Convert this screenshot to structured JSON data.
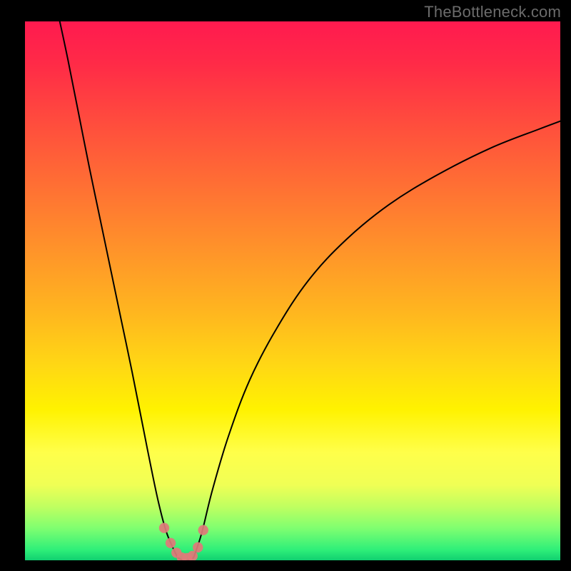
{
  "watermark": "TheBottleneck.com",
  "colors": {
    "background": "#000000",
    "watermark": "#6b6b6b",
    "curve_stroke": "#000000",
    "marker": "#e07a7a",
    "gradient_top": "#ff1a4f",
    "gradient_bottom": "#10d070"
  },
  "chart_data": {
    "type": "line",
    "title": "",
    "xlabel": "",
    "ylabel": "",
    "xlim": [
      0,
      100
    ],
    "ylim": [
      0,
      100
    ],
    "grid": false,
    "legend": false,
    "series": [
      {
        "name": "left-branch",
        "x": [
          6.5,
          8,
          10,
          12,
          14,
          16,
          18,
          20,
          22,
          23.5,
          25,
          26.5,
          28.5
        ],
        "values": [
          100,
          93,
          83,
          73,
          63.5,
          54,
          44.5,
          35,
          25,
          17.5,
          10.5,
          5,
          0.5
        ]
      },
      {
        "name": "right-branch",
        "x": [
          31.5,
          33,
          35,
          38,
          42,
          47,
          53,
          60,
          68,
          77,
          87,
          96,
          100
        ],
        "values": [
          0.5,
          5,
          13,
          23,
          33.5,
          43,
          52,
          59.5,
          66,
          71.5,
          76.5,
          80,
          81.5
        ]
      },
      {
        "name": "valley-floor",
        "x": [
          28.5,
          29.5,
          30.5,
          31.5
        ],
        "values": [
          0.5,
          0.0,
          0.0,
          0.5
        ]
      }
    ],
    "markers": {
      "name": "valley-markers",
      "color": "#e07a7a",
      "x": [
        26.0,
        27.2,
        28.3,
        29.3,
        30.3,
        31.3,
        32.3,
        33.3
      ],
      "values": [
        6.0,
        3.2,
        1.4,
        0.5,
        0.4,
        0.8,
        2.4,
        5.6
      ]
    },
    "annotations": []
  }
}
